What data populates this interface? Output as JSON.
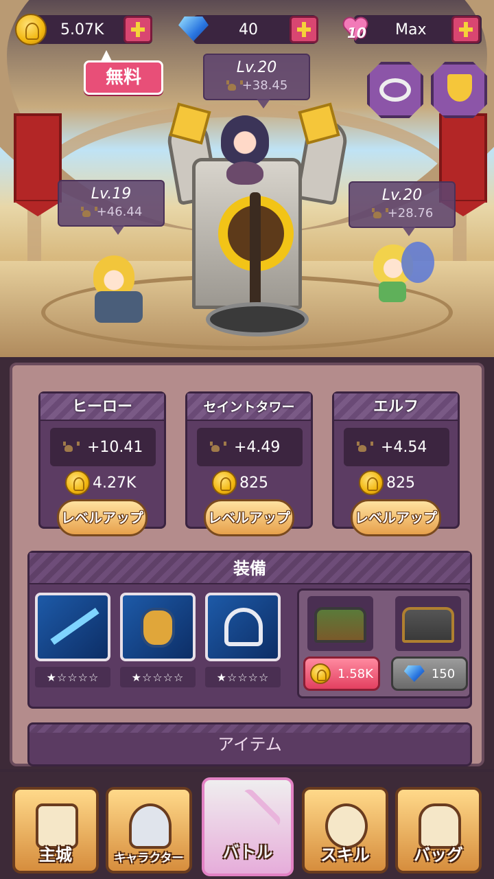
{
  "currency": {
    "gold": "5.07K",
    "gems": "40",
    "hearts_level": "10",
    "hearts": "Max"
  },
  "free_label": "無料",
  "units": [
    {
      "name": "tower-unit",
      "level": "Lv.20",
      "power": "+38.45"
    },
    {
      "name": "hero-unit",
      "level": "Lv.19",
      "power": "+46.44"
    },
    {
      "name": "elf-unit",
      "level": "Lv.20",
      "power": "+28.76"
    }
  ],
  "upgrade_cards": [
    {
      "title": "ヒーロー",
      "bonus": "+10.41",
      "cost": "4.27K",
      "button": "レベルアップ"
    },
    {
      "title": "セイントタワー",
      "bonus": "+4.49",
      "cost": "825",
      "button": "レベルアップ"
    },
    {
      "title": "エルフ",
      "bonus": "+4.54",
      "cost": "825",
      "button": "レベルアップ"
    }
  ],
  "equipment": {
    "title": "装備",
    "slots": [
      {
        "icon": "spear-icon",
        "stars": "★☆☆☆☆"
      },
      {
        "icon": "armor-icon",
        "stars": "★☆☆☆☆"
      },
      {
        "icon": "crossbow-icon",
        "stars": "★☆☆☆☆"
      }
    ],
    "chest_gold_price": "1.58K",
    "chest_gem_price": "150"
  },
  "items_title": "アイテム",
  "nav": [
    {
      "label": "主城",
      "icon": "castle-icon"
    },
    {
      "label": "キャラクター",
      "icon": "knight-helmet-icon"
    },
    {
      "label": "バトル",
      "icon": "crossed-swords-icon"
    },
    {
      "label": "スキル",
      "icon": "wind-scroll-icon"
    },
    {
      "label": "バッグ",
      "icon": "backpack-icon"
    }
  ],
  "colors": {
    "accent_pink": "#e84f78",
    "gold": "#f2b70f",
    "panel_purple": "#5c3c63"
  }
}
